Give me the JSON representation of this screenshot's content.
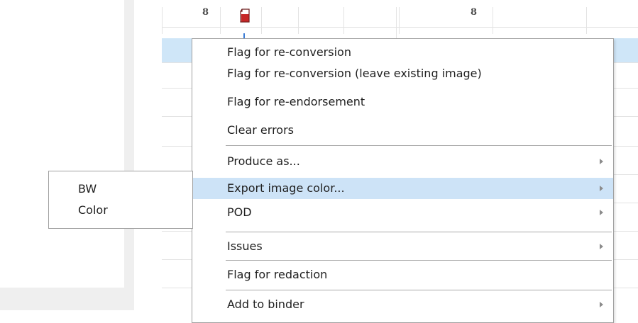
{
  "grid": {
    "numbers": [
      "8",
      "8"
    ],
    "doc_icon_color": "#c62828",
    "highlight_color": "#cfe6f8"
  },
  "context_menu": {
    "items": [
      {
        "label": "Flag for re-conversion",
        "has_submenu": false
      },
      {
        "label": "Flag for re-conversion (leave existing image)",
        "has_submenu": false
      },
      {
        "label": "Flag for re-endorsement",
        "has_submenu": false
      },
      {
        "label": "Clear errors",
        "has_submenu": false
      },
      {
        "label": "Produce as...",
        "has_submenu": true
      },
      {
        "label": "Export image color...",
        "has_submenu": true,
        "active": true
      },
      {
        "label": "POD",
        "has_submenu": true
      },
      {
        "label": "Issues",
        "has_submenu": true
      },
      {
        "label": "Flag for redaction",
        "has_submenu": false
      },
      {
        "label": "Add to binder",
        "has_submenu": true
      }
    ],
    "active_color": "#cde3f7"
  },
  "submenu": {
    "items": [
      {
        "label": "BW"
      },
      {
        "label": "Color"
      }
    ]
  }
}
